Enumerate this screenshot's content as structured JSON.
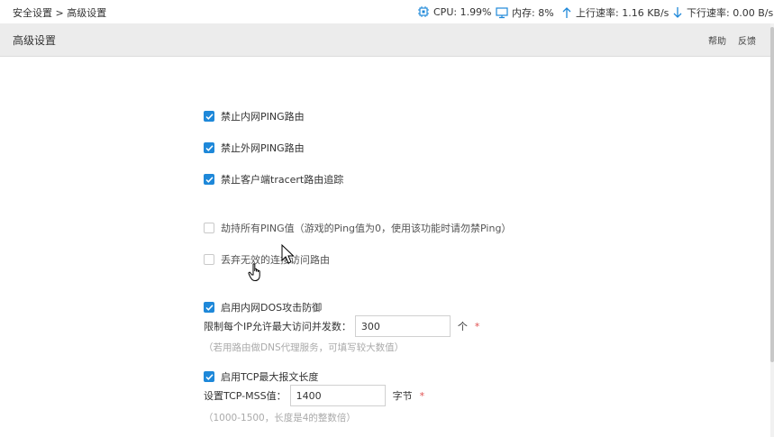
{
  "topbar": {
    "breadcrumb": "安全设置 > 高级设置",
    "cpu": "CPU: 1.99%",
    "memory": "内存: 8%",
    "upload": "上行速率: 1.16 KB/s",
    "download": "下行速率: 0.00 B/s"
  },
  "header": {
    "title": "高级设置",
    "help": "帮助",
    "feedback": "反馈"
  },
  "options": [
    {
      "label": "禁止内网PING路由",
      "checked": true
    },
    {
      "label": "禁止外网PING路由",
      "checked": true
    },
    {
      "label": "禁止客户端tracert路由追踪",
      "checked": true
    },
    {
      "label": "劫持所有PING值（游戏的Ping值为0，使用该功能时请勿禁Ping）",
      "checked": false
    },
    {
      "label": "丢弃无效的连接访问路由",
      "checked": false
    },
    {
      "label": "启用内网DOS攻击防御",
      "checked": true
    },
    {
      "label": "启用TCP最大报文长度",
      "checked": true
    }
  ],
  "dos": {
    "field_label": "限制每个IP允许最大访问并发数：",
    "value": "300",
    "unit": "个",
    "required": "*",
    "hint": "（若用路由做DNS代理服务，可填写较大数值）"
  },
  "mss": {
    "field_label": "设置TCP-MSS值：",
    "value": "1400",
    "unit": "字节",
    "required": "*",
    "hint": "（1000-1500，长度是4的整数倍）"
  },
  "colors": {
    "accent": "#1e88d9",
    "header_bg": "#ececec",
    "required": "#e05050",
    "hint": "#aaaaaa"
  }
}
